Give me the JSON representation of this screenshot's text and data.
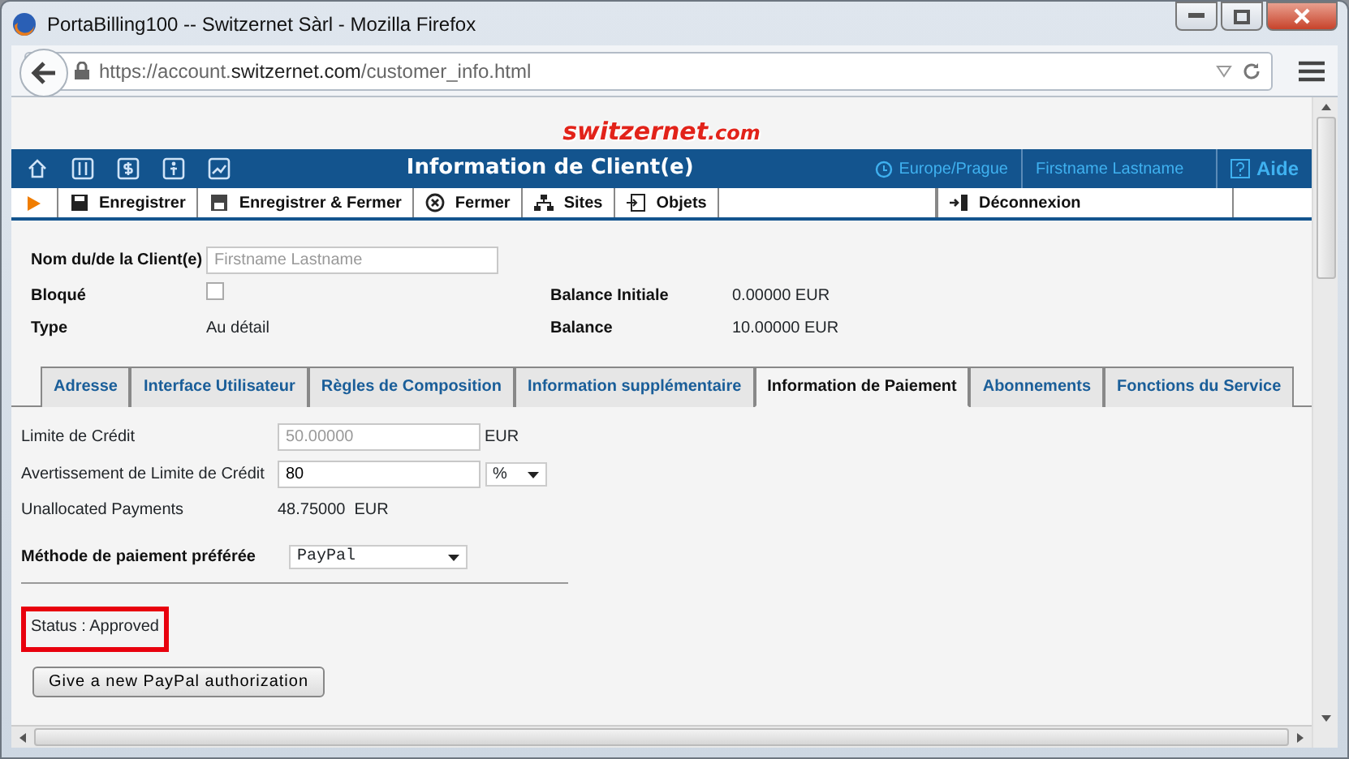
{
  "window": {
    "title": "PortaBilling100 -- Switzernet Sàrl - Mozilla Firefox"
  },
  "address_bar": {
    "url": "https://account.**switzernet.com**/customer_info.html"
  },
  "logo": {
    "text": "switzernet",
    "suffix": ".com"
  },
  "header": {
    "title": "Information de Client(e)",
    "timezone": "Europe/Prague",
    "user": "Firstname Lastname",
    "help": "Aide"
  },
  "toolbar": [
    {
      "kind": "save",
      "label": "Enregistrer"
    },
    {
      "kind": "save-close",
      "label": "Enregistrer & Fermer"
    },
    {
      "kind": "close",
      "label": "Fermer"
    },
    {
      "kind": "sites",
      "label": "Sites"
    },
    {
      "kind": "objects",
      "label": "Objets"
    }
  ],
  "logout": {
    "label": "Déconnexion"
  },
  "customer": {
    "name_label": "Nom du/de la Client(e)",
    "name_placeholder": "Firstname Lastname",
    "blocked_label": "Bloqué",
    "blocked": false,
    "type_label": "Type",
    "type": "Au détail",
    "initial_balance_label": "Balance Initiale",
    "initial_balance": "0.00000 EUR",
    "balance_label": "Balance",
    "balance": "10.00000 EUR"
  },
  "tabs": [
    {
      "label": "Adresse",
      "selected": false
    },
    {
      "label": "Interface Utilisateur",
      "selected": false
    },
    {
      "label": "Règles de Composition",
      "selected": false
    },
    {
      "label": "Information supplémentaire",
      "selected": false
    },
    {
      "label": "Information de Paiement",
      "selected": true
    },
    {
      "label": "Abonnements",
      "selected": false
    },
    {
      "label": "Fonctions du Service",
      "selected": false
    }
  ],
  "payment": {
    "credit_limit_label": "Limite de Crédit",
    "credit_limit": "50.00000",
    "credit_limit_disabled": true,
    "credit_limit_unit": "EUR",
    "warning_label": "Avertissement de Limite de Crédit",
    "warning": "80",
    "warning_unit": "%",
    "unallocated_label": "Unallocated Payments",
    "unallocated": "48.75000  EUR",
    "method_label": "Méthode de paiement préférée",
    "method": "PayPal",
    "status": "Status : Approved",
    "status_highlighted": true,
    "button": "Give a new PayPal authorization"
  }
}
